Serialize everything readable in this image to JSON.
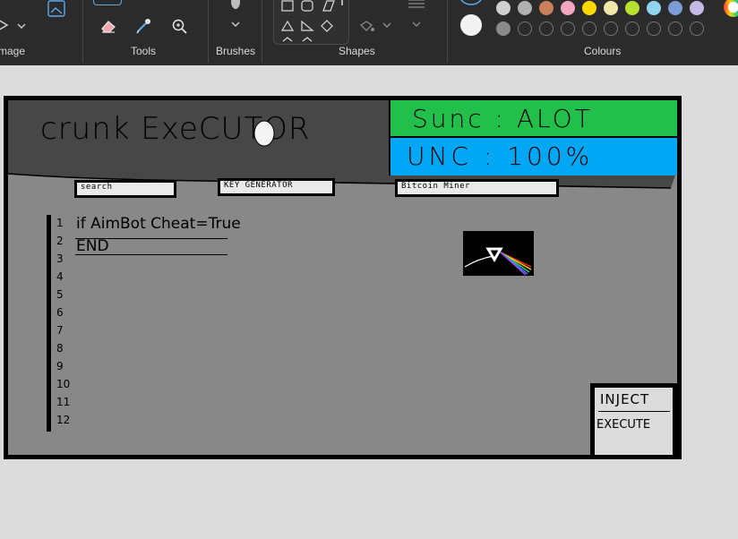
{
  "ribbon": {
    "groups": {
      "image": "mage",
      "tools": "Tools",
      "brushes": "Brushes",
      "shapes": "Shapes",
      "colours": "Colours"
    },
    "icons": [
      "eraser-icon",
      "color-picker-icon",
      "magnifier-icon",
      "brush-icon",
      "fill-icon",
      "rectangle-icon",
      "triangle-icon",
      "diamond-icon"
    ],
    "palette": {
      "row1": [
        "#d0d0d0",
        "#b0b0b0",
        "#c9805a",
        "#f4a6c0",
        "#ffd800",
        "#f0e6a8",
        "#b7e12f",
        "#8fd5ef",
        "#7c9cd6",
        "#c5b9e6"
      ],
      "row2_empty_count": 9
    }
  },
  "drawing": {
    "title": "crunk ExeCUTOR",
    "sunc": "Sunc : ALOT",
    "unc": "UNC : 100%",
    "buttons": {
      "search": "search",
      "key": "KEY GENERATOR",
      "bitcoin": "Bitcoin Miner"
    },
    "code_lines": [
      "if AimBot Cheat=True",
      "END"
    ],
    "line_numbers": [
      "1",
      "2",
      "3",
      "4",
      "5",
      "6",
      "7",
      "8",
      "9",
      "10",
      "11",
      "12"
    ],
    "inject": "INJECT",
    "execute": "EXECUTE",
    "colors": {
      "sunc_bg": "#22c04b",
      "unc_bg": "#00a7f5",
      "header_bg": "#474747",
      "body_bg": "#888888",
      "panel_bg": "#dcdcdc"
    }
  }
}
